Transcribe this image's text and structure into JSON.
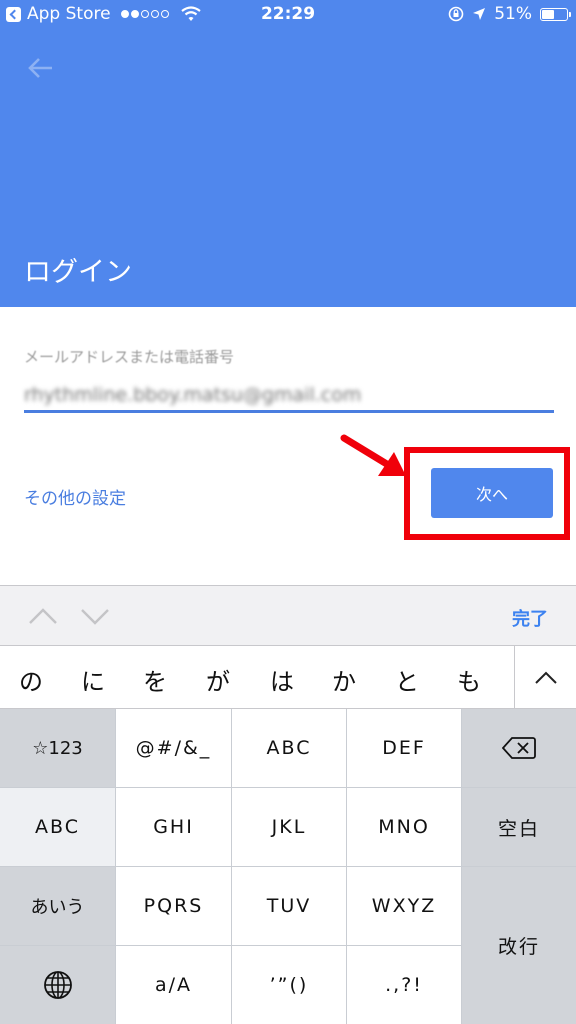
{
  "status_bar": {
    "back_app": "App Store",
    "time": "22:29",
    "battery": "51%",
    "battery_level": 0.51
  },
  "header": {
    "title": "ログイン",
    "accent_color": "#5087ed"
  },
  "form": {
    "label": "メールアドレスまたは電話番号",
    "email_value": "rhythmline.bboy.matsu@gmail.com",
    "other_settings": "その他の設定",
    "next_label": "次へ"
  },
  "annotation": {
    "highlight_color": "#f0000a"
  },
  "toolbar": {
    "done_label": "完了"
  },
  "candidates": [
    "の",
    "に",
    "を",
    "が",
    "は",
    "か",
    "と",
    "も"
  ],
  "keyboard": {
    "k_123": "☆123",
    "k_at": "@#/&_",
    "k_abc1": "ABC",
    "k_def": "DEF",
    "k_abc_mode": "ABC",
    "k_ghi": "GHI",
    "k_jkl": "JKL",
    "k_mno": "MNO",
    "k_space": "空白",
    "k_kana": "あいう",
    "k_pqrs": "PQRS",
    "k_tuv": "TUV",
    "k_wxyz": "WXYZ",
    "k_return": "改行",
    "k_case": "a/A",
    "k_quotes": "’”()",
    "k_punct": ".,?!"
  }
}
